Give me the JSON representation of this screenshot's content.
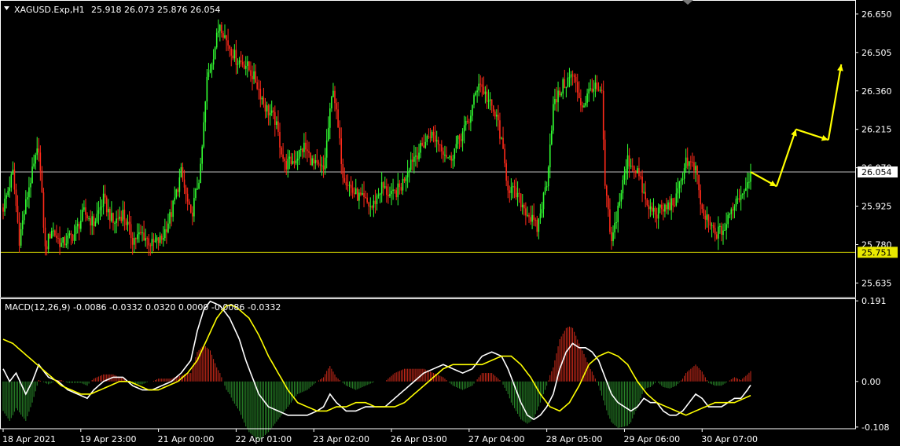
{
  "header": {
    "symbol": "XAGUSD.Exp,H1",
    "ohlc": "25.918 26.073 25.876 26.054",
    "macd_label": "MACD(12,26,9) -0.0086 -0.0332 0.0320 0.0000 -0.0086 -0.0332"
  },
  "colors": {
    "background": "#000000",
    "bull": "#32ff32",
    "bear": "#ff2a1a",
    "hline_bid": "#ffffff",
    "hline_level": "#e8e800",
    "arrow": "#ffff00",
    "macd_line": "#ffffff",
    "signal_line": "#ffff00",
    "hist_pos": "#cc2a1a",
    "hist_neg": "#2a8a2a",
    "frame": "#ffffff"
  },
  "chart_data": [
    {
      "type": "candlestick",
      "symbol": "XAGUSD.Exp",
      "timeframe": "H1",
      "ylim": [
        25.58,
        26.7
      ],
      "y_ticks": [
        "26.650",
        "26.505",
        "26.360",
        "26.215",
        "26.070",
        "25.925",
        "25.780",
        "25.635"
      ],
      "price_tags": [
        {
          "value": 26.054,
          "text": "26.054",
          "kind": "bid"
        },
        {
          "value": 25.751,
          "text": "25.751",
          "kind": "level"
        }
      ],
      "x_labels": [
        "18 Apr 2021",
        "19 Apr 23:00",
        "21 Apr 00:00",
        "22 Apr 01:00",
        "23 Apr 02:00",
        "26 Apr 03:00",
        "27 Apr 04:00",
        "28 Apr 05:00",
        "29 Apr 06:00",
        "30 Apr 07:00"
      ],
      "close_path": [
        [
          0,
          25.92
        ],
        [
          6,
          26.05
        ],
        [
          10,
          25.8
        ],
        [
          16,
          26.0
        ],
        [
          22,
          26.15
        ],
        [
          26,
          25.76
        ],
        [
          30,
          25.84
        ],
        [
          36,
          25.78
        ],
        [
          44,
          25.82
        ],
        [
          50,
          25.9
        ],
        [
          56,
          25.86
        ],
        [
          62,
          25.95
        ],
        [
          68,
          25.86
        ],
        [
          74,
          25.9
        ],
        [
          80,
          25.8
        ],
        [
          86,
          25.82
        ],
        [
          92,
          25.78
        ],
        [
          98,
          25.8
        ],
        [
          104,
          25.9
        ],
        [
          110,
          26.05
        ],
        [
          116,
          25.88
        ],
        [
          122,
          26.06
        ],
        [
          126,
          26.4
        ],
        [
          130,
          26.5
        ],
        [
          134,
          26.62
        ],
        [
          138,
          26.55
        ],
        [
          144,
          26.48
        ],
        [
          150,
          26.46
        ],
        [
          156,
          26.4
        ],
        [
          162,
          26.3
        ],
        [
          168,
          26.25
        ],
        [
          174,
          26.08
        ],
        [
          180,
          26.1
        ],
        [
          186,
          26.15
        ],
        [
          192,
          26.08
        ],
        [
          198,
          26.06
        ],
        [
          204,
          26.38
        ],
        [
          210,
          26.05
        ],
        [
          216,
          25.98
        ],
        [
          222,
          25.95
        ],
        [
          228,
          25.92
        ],
        [
          234,
          26.0
        ],
        [
          240,
          25.96
        ],
        [
          246,
          26.0
        ],
        [
          252,
          26.1
        ],
        [
          258,
          26.14
        ],
        [
          264,
          26.2
        ],
        [
          270,
          26.16
        ],
        [
          276,
          26.1
        ],
        [
          282,
          26.18
        ],
        [
          288,
          26.25
        ],
        [
          294,
          26.4
        ],
        [
          300,
          26.32
        ],
        [
          306,
          26.24
        ],
        [
          312,
          26.0
        ],
        [
          318,
          25.96
        ],
        [
          324,
          25.9
        ],
        [
          330,
          25.84
        ],
        [
          336,
          26.02
        ],
        [
          340,
          26.3
        ],
        [
          346,
          26.38
        ],
        [
          352,
          26.42
        ],
        [
          358,
          26.3
        ],
        [
          364,
          26.38
        ],
        [
          370,
          26.34
        ],
        [
          372,
          26.0
        ],
        [
          376,
          25.78
        ],
        [
          380,
          25.92
        ],
        [
          386,
          26.1
        ],
        [
          392,
          26.06
        ],
        [
          398,
          25.92
        ],
        [
          404,
          25.9
        ],
        [
          410,
          25.92
        ],
        [
          416,
          25.95
        ],
        [
          422,
          26.1
        ],
        [
          428,
          26.06
        ],
        [
          432,
          25.9
        ],
        [
          436,
          25.86
        ],
        [
          440,
          25.82
        ],
        [
          446,
          25.84
        ],
        [
          452,
          25.94
        ],
        [
          458,
          25.99
        ],
        [
          462,
          26.054
        ]
      ],
      "forecast_arrows": [
        [
          [
            462,
            26.054
          ],
          [
            478,
            26.0
          ]
        ],
        [
          [
            478,
            26.0
          ],
          [
            490,
            26.215
          ]
        ],
        [
          [
            490,
            26.215
          ],
          [
            510,
            26.175
          ]
        ],
        [
          [
            510,
            26.175
          ],
          [
            518,
            26.46
          ]
        ]
      ]
    },
    {
      "type": "macd",
      "params": "12,26,9",
      "ylim": [
        -0.112,
        0.195
      ],
      "y_ticks": [
        "0.191",
        "0.00",
        "-0.108"
      ],
      "macd_path": [
        [
          0,
          0.03
        ],
        [
          4,
          0.0
        ],
        [
          8,
          0.02
        ],
        [
          14,
          -0.03
        ],
        [
          18,
          0.0
        ],
        [
          22,
          0.04
        ],
        [
          28,
          0.01
        ],
        [
          34,
          0.0
        ],
        [
          40,
          -0.02
        ],
        [
          46,
          -0.03
        ],
        [
          52,
          -0.04
        ],
        [
          56,
          -0.02
        ],
        [
          62,
          0.0
        ],
        [
          68,
          0.01
        ],
        [
          74,
          0.01
        ],
        [
          80,
          -0.01
        ],
        [
          86,
          -0.02
        ],
        [
          92,
          -0.02
        ],
        [
          98,
          -0.01
        ],
        [
          104,
          0.0
        ],
        [
          110,
          0.02
        ],
        [
          116,
          0.05
        ],
        [
          120,
          0.12
        ],
        [
          124,
          0.17
        ],
        [
          128,
          0.19
        ],
        [
          134,
          0.18
        ],
        [
          140,
          0.15
        ],
        [
          146,
          0.1
        ],
        [
          150,
          0.05
        ],
        [
          154,
          0.01
        ],
        [
          158,
          -0.03
        ],
        [
          164,
          -0.06
        ],
        [
          170,
          -0.07
        ],
        [
          176,
          -0.08
        ],
        [
          182,
          -0.08
        ],
        [
          188,
          -0.08
        ],
        [
          194,
          -0.07
        ],
        [
          198,
          -0.06
        ],
        [
          202,
          -0.03
        ],
        [
          206,
          -0.05
        ],
        [
          212,
          -0.07
        ],
        [
          218,
          -0.07
        ],
        [
          224,
          -0.06
        ],
        [
          230,
          -0.06
        ],
        [
          236,
          -0.06
        ],
        [
          242,
          -0.04
        ],
        [
          248,
          -0.02
        ],
        [
          254,
          0.0
        ],
        [
          260,
          0.02
        ],
        [
          266,
          0.03
        ],
        [
          272,
          0.04
        ],
        [
          278,
          0.03
        ],
        [
          284,
          0.02
        ],
        [
          290,
          0.03
        ],
        [
          296,
          0.06
        ],
        [
          302,
          0.07
        ],
        [
          308,
          0.06
        ],
        [
          312,
          0.03
        ],
        [
          316,
          -0.01
        ],
        [
          320,
          -0.05
        ],
        [
          324,
          -0.08
        ],
        [
          328,
          -0.09
        ],
        [
          332,
          -0.08
        ],
        [
          336,
          -0.06
        ],
        [
          340,
          -0.03
        ],
        [
          344,
          0.03
        ],
        [
          348,
          0.07
        ],
        [
          352,
          0.09
        ],
        [
          356,
          0.08
        ],
        [
          360,
          0.08
        ],
        [
          364,
          0.07
        ],
        [
          368,
          0.05
        ],
        [
          372,
          0.01
        ],
        [
          376,
          -0.03
        ],
        [
          380,
          -0.05
        ],
        [
          384,
          -0.06
        ],
        [
          388,
          -0.07
        ],
        [
          392,
          -0.06
        ],
        [
          396,
          -0.04
        ],
        [
          400,
          -0.05
        ],
        [
          404,
          -0.05
        ],
        [
          408,
          -0.07
        ],
        [
          412,
          -0.08
        ],
        [
          416,
          -0.08
        ],
        [
          420,
          -0.07
        ],
        [
          424,
          -0.05
        ],
        [
          428,
          -0.03
        ],
        [
          432,
          -0.04
        ],
        [
          436,
          -0.06
        ],
        [
          440,
          -0.06
        ],
        [
          444,
          -0.06
        ],
        [
          448,
          -0.05
        ],
        [
          452,
          -0.04
        ],
        [
          456,
          -0.04
        ],
        [
          460,
          -0.02
        ],
        [
          462,
          -0.0086
        ]
      ],
      "signal_path": [
        [
          0,
          0.1
        ],
        [
          6,
          0.09
        ],
        [
          12,
          0.07
        ],
        [
          18,
          0.05
        ],
        [
          24,
          0.03
        ],
        [
          30,
          0.01
        ],
        [
          36,
          -0.01
        ],
        [
          42,
          -0.02
        ],
        [
          48,
          -0.03
        ],
        [
          54,
          -0.03
        ],
        [
          60,
          -0.02
        ],
        [
          66,
          -0.01
        ],
        [
          72,
          0.0
        ],
        [
          78,
          0.0
        ],
        [
          84,
          -0.01
        ],
        [
          90,
          -0.02
        ],
        [
          96,
          -0.02
        ],
        [
          102,
          -0.01
        ],
        [
          108,
          0.0
        ],
        [
          114,
          0.02
        ],
        [
          120,
          0.05
        ],
        [
          126,
          0.1
        ],
        [
          132,
          0.15
        ],
        [
          138,
          0.18
        ],
        [
          142,
          0.18
        ],
        [
          146,
          0.17
        ],
        [
          152,
          0.15
        ],
        [
          158,
          0.11
        ],
        [
          164,
          0.06
        ],
        [
          170,
          0.02
        ],
        [
          176,
          -0.02
        ],
        [
          182,
          -0.05
        ],
        [
          188,
          -0.06
        ],
        [
          194,
          -0.07
        ],
        [
          200,
          -0.07
        ],
        [
          206,
          -0.06
        ],
        [
          212,
          -0.06
        ],
        [
          218,
          -0.05
        ],
        [
          224,
          -0.05
        ],
        [
          230,
          -0.06
        ],
        [
          236,
          -0.06
        ],
        [
          242,
          -0.06
        ],
        [
          248,
          -0.05
        ],
        [
          254,
          -0.03
        ],
        [
          260,
          -0.01
        ],
        [
          266,
          0.01
        ],
        [
          272,
          0.03
        ],
        [
          278,
          0.04
        ],
        [
          284,
          0.04
        ],
        [
          290,
          0.04
        ],
        [
          296,
          0.04
        ],
        [
          302,
          0.05
        ],
        [
          308,
          0.06
        ],
        [
          314,
          0.06
        ],
        [
          320,
          0.04
        ],
        [
          326,
          0.01
        ],
        [
          332,
          -0.03
        ],
        [
          338,
          -0.06
        ],
        [
          344,
          -0.07
        ],
        [
          350,
          -0.05
        ],
        [
          356,
          -0.01
        ],
        [
          362,
          0.04
        ],
        [
          368,
          0.06
        ],
        [
          374,
          0.07
        ],
        [
          380,
          0.06
        ],
        [
          386,
          0.04
        ],
        [
          392,
          0.0
        ],
        [
          398,
          -0.03
        ],
        [
          404,
          -0.05
        ],
        [
          410,
          -0.06
        ],
        [
          416,
          -0.07
        ],
        [
          422,
          -0.08
        ],
        [
          428,
          -0.07
        ],
        [
          434,
          -0.06
        ],
        [
          440,
          -0.05
        ],
        [
          446,
          -0.05
        ],
        [
          452,
          -0.05
        ],
        [
          458,
          -0.04
        ],
        [
          462,
          -0.0332
        ]
      ]
    }
  ]
}
